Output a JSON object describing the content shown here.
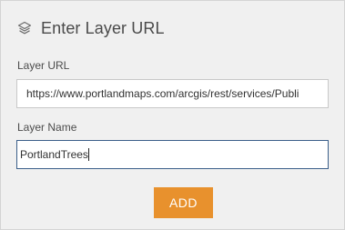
{
  "dialog": {
    "title": "Enter Layer URL",
    "header_icon": "layers-icon"
  },
  "fields": {
    "layer_url": {
      "label": "Layer URL",
      "value": "https://www.portlandmaps.com/arcgis/rest/services/Publi"
    },
    "layer_name": {
      "label": "Layer Name",
      "value": "PortlandTrees"
    }
  },
  "actions": {
    "add_label": "ADD"
  },
  "colors": {
    "accent": "#e8912d",
    "focus_border": "#3b5f8a",
    "panel_bg": "#f0f0f0"
  }
}
